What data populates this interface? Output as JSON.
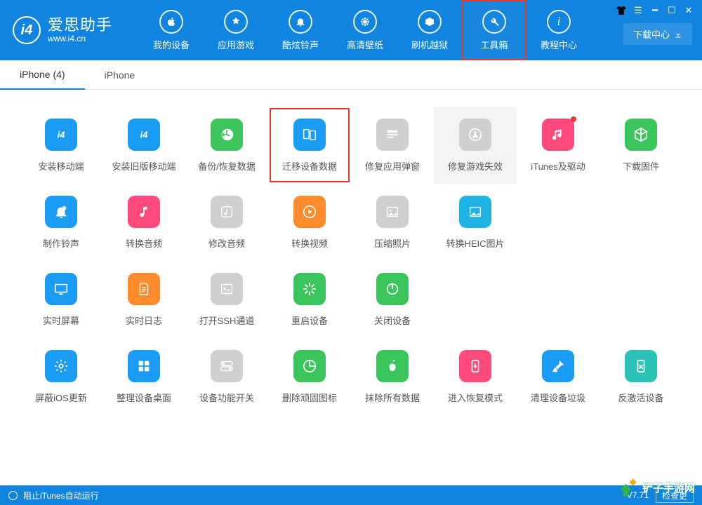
{
  "brand": {
    "name": "爱思助手",
    "url": "www.i4.cn",
    "logo_letter": "i4"
  },
  "titlebar": {
    "download_center": "下载中心"
  },
  "nav": [
    {
      "key": "device",
      "label": "我的设备"
    },
    {
      "key": "apps",
      "label": "应用游戏"
    },
    {
      "key": "ring",
      "label": "酷炫铃声"
    },
    {
      "key": "wall",
      "label": "高清壁纸"
    },
    {
      "key": "flash",
      "label": "刷机越狱"
    },
    {
      "key": "toolbox",
      "label": "工具箱",
      "highlight": true
    },
    {
      "key": "tutorial",
      "label": "教程中心"
    }
  ],
  "tabs": [
    {
      "label": "iPhone (4)",
      "active": true
    },
    {
      "label": "iPhone",
      "active": false
    }
  ],
  "tools": [
    {
      "label": "安装移动端",
      "icon": "i4-logo",
      "color": "c-blue"
    },
    {
      "label": "安装旧版移动端",
      "icon": "i4-logo",
      "color": "c-blue"
    },
    {
      "label": "备份/恢复数据",
      "icon": "clock-back",
      "color": "c-green"
    },
    {
      "label": "迁移设备数据",
      "icon": "devices",
      "color": "c-blue",
      "boxhl": true
    },
    {
      "label": "修复应用弹窗",
      "icon": "appleid",
      "color": "c-gray"
    },
    {
      "label": "修复游戏失效",
      "icon": "appstore",
      "color": "c-gray",
      "graybox": true
    },
    {
      "label": "iTunes及驱动",
      "icon": "music",
      "color": "c-pink",
      "badge": true
    },
    {
      "label": "下载固件",
      "icon": "cube",
      "color": "c-green"
    },
    {
      "label": "制作铃声",
      "icon": "bell",
      "color": "c-blue"
    },
    {
      "label": "转换音频",
      "icon": "note",
      "color": "c-pink"
    },
    {
      "label": "修改音频",
      "icon": "note-box",
      "color": "c-gray"
    },
    {
      "label": "转换视频",
      "icon": "play",
      "color": "c-orange"
    },
    {
      "label": "压缩照片",
      "icon": "photo",
      "color": "c-gray"
    },
    {
      "label": "转换HEIC图片",
      "icon": "heic",
      "color": "c-cyan"
    },
    {
      "label": "实时屏幕",
      "icon": "monitor",
      "color": "c-blue"
    },
    {
      "label": "实时日志",
      "icon": "doc",
      "color": "c-orange"
    },
    {
      "label": "打开SSH通道",
      "icon": "terminal",
      "color": "c-gray"
    },
    {
      "label": "重启设备",
      "icon": "loading",
      "color": "c-green"
    },
    {
      "label": "关闭设备",
      "icon": "power",
      "color": "c-green"
    },
    {
      "label": "屏蔽iOS更新",
      "icon": "gear",
      "color": "c-blue"
    },
    {
      "label": "整理设备桌面",
      "icon": "grid",
      "color": "c-blue"
    },
    {
      "label": "设备功能开关",
      "icon": "toggles",
      "color": "c-gray"
    },
    {
      "label": "删除顽固图标",
      "icon": "pie",
      "color": "c-green"
    },
    {
      "label": "抹除所有数据",
      "icon": "apple",
      "color": "c-green"
    },
    {
      "label": "进入恢复模式",
      "icon": "phone-arrow",
      "color": "c-pink"
    },
    {
      "label": "清理设备垃圾",
      "icon": "broom",
      "color": "c-blue"
    },
    {
      "label": "反激活设备",
      "icon": "phone-x",
      "color": "c-teal"
    }
  ],
  "row_sizes": [
    8,
    6,
    5,
    8
  ],
  "footer": {
    "block_itunes": "阻止iTunes自动运行",
    "version": "V7.71",
    "check_update": "检查更"
  },
  "watermark": "铲子手游网"
}
